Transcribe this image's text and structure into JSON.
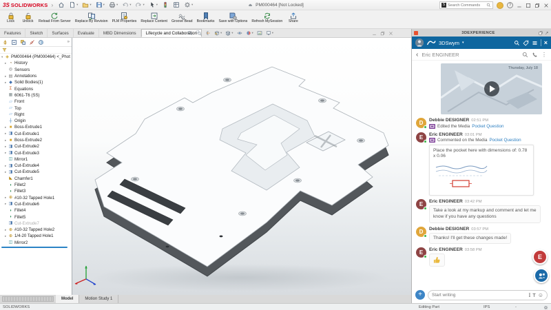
{
  "titlebar": {
    "logo_mark": "3S",
    "logo_text": "SOLIDWORKS",
    "doc_title": "PM000464 [Not Locked]",
    "search_placeholder": "Search Commands",
    "help_label": "?"
  },
  "quick_access": [
    {
      "icon": "home",
      "caret": false
    },
    {
      "icon": "new-doc",
      "caret": true
    },
    {
      "icon": "open-folder",
      "caret": true
    },
    {
      "icon": "save",
      "caret": true
    },
    {
      "icon": "print",
      "caret": true
    },
    {
      "icon": "undo",
      "caret": true
    },
    {
      "icon": "redo",
      "caret": true
    },
    {
      "icon": "select-cursor",
      "caret": true
    },
    {
      "icon": "traffic-light",
      "caret": false
    },
    {
      "icon": "file-grid",
      "caret": false
    },
    {
      "icon": "options-gear",
      "caret": true
    }
  ],
  "ribbon_buttons": [
    {
      "label": "Lock",
      "icon": "lock"
    },
    {
      "label": "Unlock",
      "icon": "unlock"
    },
    {
      "label": "Reload From Server",
      "icon": "reload"
    },
    {
      "label": "Replace By Revision",
      "icon": "replace-rev"
    },
    {
      "label": "PLM Properties",
      "icon": "plm-props"
    },
    {
      "label": "Replace Content",
      "icon": "replace-content"
    },
    {
      "label": "Groove Bead",
      "icon": "groove-bead"
    },
    {
      "label": "Bookmarks",
      "icon": "bookmarks"
    },
    {
      "label": "Save with Options",
      "icon": "save-options"
    },
    {
      "label": "Refresh MySession",
      "icon": "refresh"
    },
    {
      "label": "Share",
      "icon": "share"
    }
  ],
  "command_tabs": {
    "tabs": [
      "Features",
      "Sketch",
      "Surfaces",
      "Evaluate",
      "MBD Dimensions",
      "Lifecycle and Collaboration"
    ],
    "active_index": 5
  },
  "headsup_icons": [
    "zoom-fit",
    "zoom-area",
    "previous-view",
    "section-view",
    "display-style",
    "hide-show-items",
    "edit-appearance",
    "apply-scene",
    "view-settings"
  ],
  "manager_tabs": [
    "featuremanager",
    "propertymanager",
    "configurationmanager",
    "dimxpertmanager",
    "displaymanager"
  ],
  "feature_tree": {
    "root": "PM000464 (PM000464) <<Default>_Phot",
    "items": [
      {
        "label": "History",
        "icon": "history",
        "expand": true
      },
      {
        "label": "Sensors",
        "icon": "sensors"
      },
      {
        "label": "Annotations",
        "icon": "annotations",
        "expand": true
      },
      {
        "label": "Solid Bodies(1)",
        "icon": "solid-bodies",
        "expand": true
      },
      {
        "label": "Equations",
        "icon": "equations"
      },
      {
        "label": "6061-T6 (SS)",
        "icon": "material"
      },
      {
        "label": "Front",
        "icon": "plane"
      },
      {
        "label": "Top",
        "icon": "plane"
      },
      {
        "label": "Right",
        "icon": "plane"
      },
      {
        "label": "Origin",
        "icon": "origin"
      },
      {
        "label": "Boss-Extrude1",
        "icon": "boss-extrude",
        "expand": true
      },
      {
        "label": "Cut-Extrude1",
        "icon": "cut-extrude",
        "expand": true
      },
      {
        "label": "Boss-Extrude2",
        "icon": "boss-extrude",
        "expand": true
      },
      {
        "label": "Cut-Extrude2",
        "icon": "cut-extrude",
        "expand": true
      },
      {
        "label": "Cut-Extrude3",
        "icon": "cut-extrude",
        "expand": true
      },
      {
        "label": "Mirror1",
        "icon": "mirror"
      },
      {
        "label": "Cut-Extrude4",
        "icon": "cut-extrude",
        "expand": true
      },
      {
        "label": "Cut-Extrude5",
        "icon": "cut-extrude",
        "expand": true
      },
      {
        "label": "Chamfer1",
        "icon": "chamfer"
      },
      {
        "label": "Fillet2",
        "icon": "fillet"
      },
      {
        "label": "Fillet3",
        "icon": "fillet"
      },
      {
        "label": "#10-32 Tapped Hole1",
        "icon": "tapped-hole",
        "expand": true
      },
      {
        "label": "Cut-Extrude6",
        "icon": "cut-extrude",
        "expand": true
      },
      {
        "label": "Fillet4",
        "icon": "fillet"
      },
      {
        "label": "Fillet5",
        "icon": "fillet"
      },
      {
        "label": "Cut-Extrude7",
        "icon": "cut-extrude",
        "grayed": true
      },
      {
        "label": "#10-32 Tapped Hole2",
        "icon": "tapped-hole",
        "expand": true
      },
      {
        "label": "1/4-20 Tapped Hole1",
        "icon": "tapped-hole",
        "expand": true
      },
      {
        "label": "Mirror2",
        "icon": "mirror"
      }
    ]
  },
  "model_tabs": {
    "tabs": [
      "Model",
      "Motion Study 1"
    ],
    "active_index": 0
  },
  "statusbar": {
    "left": "SOLIDWORKS",
    "mode": "Editing Part",
    "units": "IPS",
    "dash": "-"
  },
  "right_panel": {
    "title": "3DEXPERIENCE",
    "app_name": "3DSwym",
    "conversation_name": "Eric ENGINEER",
    "video_date": "Thursday, July 18",
    "composer_placeholder": "Start writing",
    "text_tool_label": "T",
    "messages": [
      {
        "kind": "activity",
        "author": "Debbie DESIGNER",
        "time": "02:51 PM",
        "action": "Edited the Media",
        "link": "Pocket Question"
      },
      {
        "kind": "comment",
        "author": "Eric ENGINEER",
        "time": "03:01 PM",
        "action": "Commented on the Media",
        "link": "Pocket Question",
        "text": "Place the pocket here with dimensions of:  0.78 x 0.06"
      },
      {
        "kind": "bubble",
        "author": "Eric ENGINEER",
        "time": "03:42 PM",
        "text": "Take a look at my markup and comment and let me know if you have any questions"
      },
      {
        "kind": "bubble",
        "author": "Debbie DESIGNER",
        "time": "03:57 PM",
        "text": "Thanks!  I'll get these changes made!"
      },
      {
        "kind": "emoji",
        "author": "Eric ENGINEER",
        "time": "03:58 PM",
        "icon": "thumbs-up"
      }
    ]
  },
  "people": {
    "Debbie DESIGNER": {
      "initial": "D",
      "color": "#e0a63a"
    },
    "Eric ENGINEER": {
      "initial": "E",
      "color": "#8e4444"
    }
  },
  "floating_contacts": [
    {
      "kind": "avatar",
      "initial": "E",
      "color": "#c23b3b"
    },
    {
      "kind": "community"
    }
  ]
}
